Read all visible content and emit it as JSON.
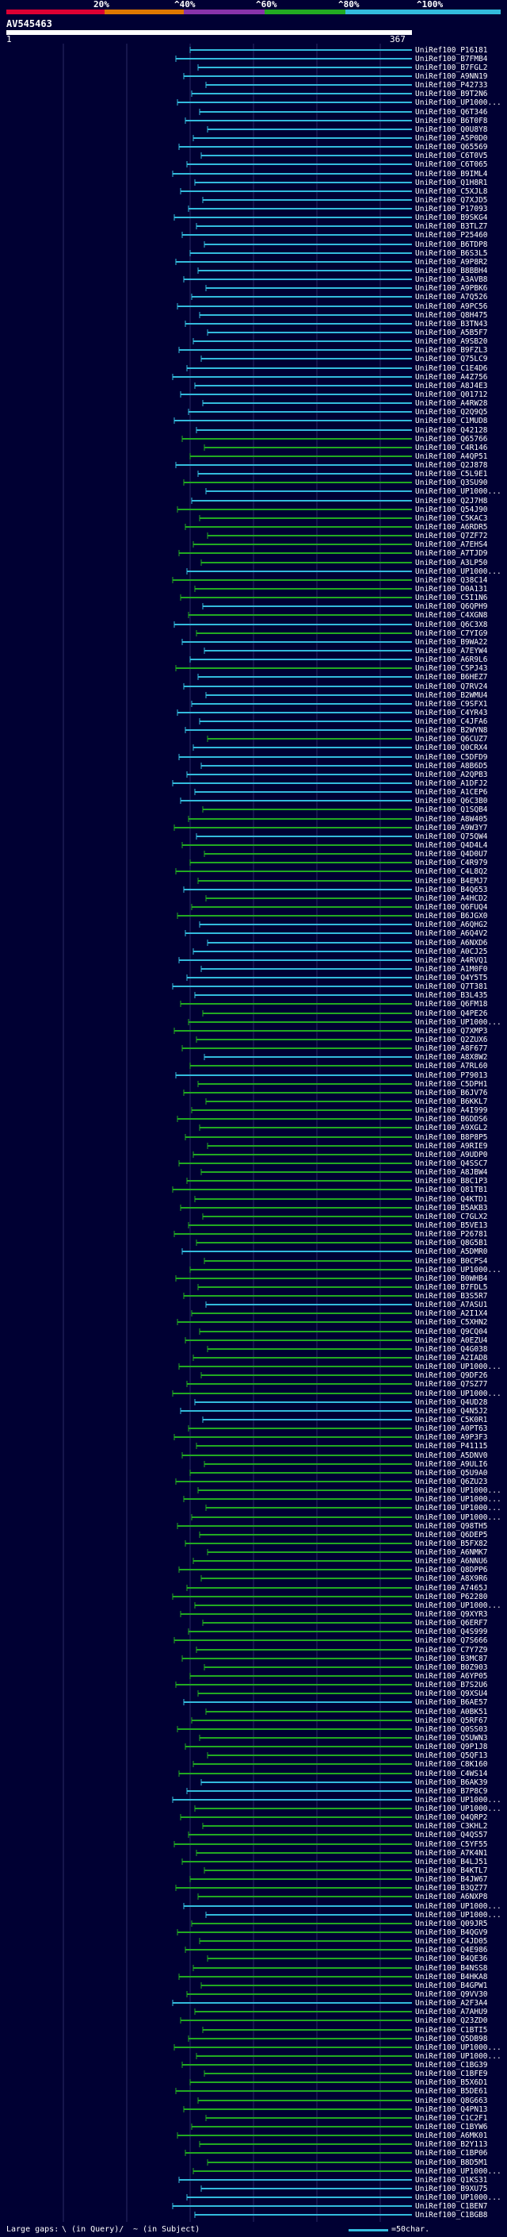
{
  "colors": {
    "background": "#000033",
    "query": "#ffffff",
    "band_20": "#dd0033",
    "band_40": "#dd7700",
    "band_60": "#8833aa",
    "band_80": "#22aa22",
    "band_100": "#33bbdd",
    "grid": "#2a2a66"
  },
  "scale": {
    "labels": [
      "20%",
      "^40%",
      "^60%",
      "^80%",
      "^100%"
    ]
  },
  "query": {
    "id": "AV545463",
    "start": "1",
    "end": "367"
  },
  "hits": [
    {
      "label": "UniRef100_P16181",
      "identity": 100
    },
    {
      "label": "UniRef100_B7FMB4",
      "identity": 100
    },
    {
      "label": "UniRef100_B7FGL2",
      "identity": 100
    },
    {
      "label": "UniRef100_A9NN19",
      "identity": 100
    },
    {
      "label": "UniRef100_P42733",
      "identity": 100
    },
    {
      "label": "UniRef100_B9T2N6",
      "identity": 100
    },
    {
      "label": "UniRef100_UP1000...",
      "identity": 100
    },
    {
      "label": "UniRef100_Q6T346",
      "identity": 100
    },
    {
      "label": "UniRef100_B6T0F8",
      "identity": 100
    },
    {
      "label": "UniRef100_Q0U8Y8",
      "identity": 100
    },
    {
      "label": "UniRef100_A5P0D0",
      "identity": 100
    },
    {
      "label": "UniRef100_Q65569",
      "identity": 100
    },
    {
      "label": "UniRef100_C6T0V5",
      "identity": 100
    },
    {
      "label": "UniRef100_C6T065",
      "identity": 100
    },
    {
      "label": "UniRef100_B9IML4",
      "identity": 100
    },
    {
      "label": "UniRef100_Q1H8R1",
      "identity": 100
    },
    {
      "label": "UniRef100_C5XJL8",
      "identity": 100
    },
    {
      "label": "UniRef100_Q7XJD5",
      "identity": 100
    },
    {
      "label": "UniRef100_P17093",
      "identity": 100
    },
    {
      "label": "UniRef100_B9SKG4",
      "identity": 100
    },
    {
      "label": "UniRef100_B3TLZ7",
      "identity": 100
    },
    {
      "label": "UniRef100_P25460",
      "identity": 100
    },
    {
      "label": "UniRef100_B6TDP8",
      "identity": 100
    },
    {
      "label": "UniRef100_B6S3L5",
      "identity": 100
    },
    {
      "label": "UniRef100_A9P8R2",
      "identity": 100
    },
    {
      "label": "UniRef100_B8BBH4",
      "identity": 100
    },
    {
      "label": "UniRef100_A3AVB8",
      "identity": 100
    },
    {
      "label": "UniRef100_A9PBK6",
      "identity": 100
    },
    {
      "label": "UniRef100_A7Q526",
      "identity": 100
    },
    {
      "label": "UniRef100_A9PC56",
      "identity": 100
    },
    {
      "label": "UniRef100_Q8H475",
      "identity": 100
    },
    {
      "label": "UniRef100_B3TN43",
      "identity": 100
    },
    {
      "label": "UniRef100_A5B5F7",
      "identity": 100
    },
    {
      "label": "UniRef100_A9SB20",
      "identity": 100
    },
    {
      "label": "UniRef100_B9FZL3",
      "identity": 100
    },
    {
      "label": "UniRef100_Q75LC9",
      "identity": 100
    },
    {
      "label": "UniRef100_C1E4D6",
      "identity": 100
    },
    {
      "label": "UniRef100_A4Z756",
      "identity": 100
    },
    {
      "label": "UniRef100_A8J4E3",
      "identity": 100
    },
    {
      "label": "UniRef100_Q01712",
      "identity": 100
    },
    {
      "label": "UniRef100_A4RW28",
      "identity": 100
    },
    {
      "label": "UniRef100_Q2Q9Q5",
      "identity": 100
    },
    {
      "label": "UniRef100_C1MUD8",
      "identity": 100
    },
    {
      "label": "UniRef100_Q42128",
      "identity": 100
    },
    {
      "label": "UniRef100_Q65766",
      "identity": 80
    },
    {
      "label": "UniRef100_C4R146",
      "identity": 80
    },
    {
      "label": "UniRef100_A4QP51",
      "identity": 80
    },
    {
      "label": "UniRef100_Q2J878",
      "identity": 100
    },
    {
      "label": "UniRef100_C5L9E1",
      "identity": 100
    },
    {
      "label": "UniRef100_Q3SU90",
      "identity": 80
    },
    {
      "label": "UniRef100_UP1000...",
      "identity": 100
    },
    {
      "label": "UniRef100_Q2J7H8",
      "identity": 100
    },
    {
      "label": "UniRef100_Q54J90",
      "identity": 80
    },
    {
      "label": "UniRef100_C5KAC3",
      "identity": 80
    },
    {
      "label": "UniRef100_A6RDR5",
      "identity": 80
    },
    {
      "label": "UniRef100_Q7ZF72",
      "identity": 80
    },
    {
      "label": "UniRef100_A7EHS4",
      "identity": 80
    },
    {
      "label": "UniRef100_A7TJD9",
      "identity": 80
    },
    {
      "label": "UniRef100_A3LP50",
      "identity": 80
    },
    {
      "label": "UniRef100_UP1000...",
      "identity": 100
    },
    {
      "label": "UniRef100_Q38C14",
      "identity": 80
    },
    {
      "label": "UniRef100_D0A131",
      "identity": 80
    },
    {
      "label": "UniRef100_C5I1N6",
      "identity": 80
    },
    {
      "label": "UniRef100_Q6QPH9",
      "identity": 100
    },
    {
      "label": "UniRef100_C4XGN8",
      "identity": 80
    },
    {
      "label": "UniRef100_Q6C3X8",
      "identity": 100
    },
    {
      "label": "UniRef100_C7YIG9",
      "identity": 80
    },
    {
      "label": "UniRef100_B9WA22",
      "identity": 100
    },
    {
      "label": "UniRef100_A7EYW4",
      "identity": 100
    },
    {
      "label": "UniRef100_A6R9L6",
      "identity": 100
    },
    {
      "label": "UniRef100_C5PJ43",
      "identity": 80
    },
    {
      "label": "UniRef100_B6HEZ7",
      "identity": 100
    },
    {
      "label": "UniRef100_Q7RV24",
      "identity": 100
    },
    {
      "label": "UniRef100_B2WMU4",
      "identity": 100
    },
    {
      "label": "UniRef100_C9SFX1",
      "identity": 100
    },
    {
      "label": "UniRef100_C4YR43",
      "identity": 100
    },
    {
      "label": "UniRef100_C4JFA6",
      "identity": 100
    },
    {
      "label": "UniRef100_B2WYN8",
      "identity": 100
    },
    {
      "label": "UniRef100_Q6CUZ7",
      "identity": 80
    },
    {
      "label": "UniRef100_Q0CRX4",
      "identity": 100
    },
    {
      "label": "UniRef100_C5DFD9",
      "identity": 100
    },
    {
      "label": "UniRef100_A8B6D5",
      "identity": 100
    },
    {
      "label": "UniRef100_A2QPB3",
      "identity": 100
    },
    {
      "label": "UniRef100_A1DFJ2",
      "identity": 100
    },
    {
      "label": "UniRef100_A1CEP6",
      "identity": 100
    },
    {
      "label": "UniRef100_Q6C3B0",
      "identity": 100
    },
    {
      "label": "UniRef100_Q1SQB4",
      "identity": 80
    },
    {
      "label": "UniRef100_A8W405",
      "identity": 80
    },
    {
      "label": "UniRef100_A9W3Y7",
      "identity": 80
    },
    {
      "label": "UniRef100_Q75QW4",
      "identity": 100
    },
    {
      "label": "UniRef100_Q4D4L4",
      "identity": 80
    },
    {
      "label": "UniRef100_Q4D0U7",
      "identity": 80
    },
    {
      "label": "UniRef100_C4R979",
      "identity": 80
    },
    {
      "label": "UniRef100_C4L8Q2",
      "identity": 80
    },
    {
      "label": "UniRef100_B4EMJ7",
      "identity": 80
    },
    {
      "label": "UniRef100_B4Q653",
      "identity": 100
    },
    {
      "label": "UniRef100_A4HCD2",
      "identity": 80
    },
    {
      "label": "UniRef100_Q6FUQ4",
      "identity": 80
    },
    {
      "label": "UniRef100_B6JGX0",
      "identity": 80
    },
    {
      "label": "UniRef100_A6QHG2",
      "identity": 100
    },
    {
      "label": "UniRef100_A6Q4V2",
      "identity": 100
    },
    {
      "label": "UniRef100_A6NXD6",
      "identity": 100
    },
    {
      "label": "UniRef100_A0CJ25",
      "identity": 100
    },
    {
      "label": "UniRef100_A4RVQ1",
      "identity": 100
    },
    {
      "label": "UniRef100_A1M0F0",
      "identity": 100
    },
    {
      "label": "UniRef100_Q4Y5T5",
      "identity": 100
    },
    {
      "label": "UniRef100_Q7T381",
      "identity": 100
    },
    {
      "label": "UniRef100_B3L435",
      "identity": 100
    },
    {
      "label": "UniRef100_Q6FM18",
      "identity": 80
    },
    {
      "label": "UniRef100_Q4PE26",
      "identity": 80
    },
    {
      "label": "UniRef100_UP1000...",
      "identity": 80
    },
    {
      "label": "UniRef100_Q7XMP3",
      "identity": 80
    },
    {
      "label": "UniRef100_Q2ZUX6",
      "identity": 80
    },
    {
      "label": "UniRef100_A8F677",
      "identity": 80
    },
    {
      "label": "UniRef100_A8X8W2",
      "identity": 100
    },
    {
      "label": "UniRef100_A7RL60",
      "identity": 80
    },
    {
      "label": "UniRef100_P79013",
      "identity": 100
    },
    {
      "label": "UniRef100_C5DPH1",
      "identity": 80
    },
    {
      "label": "UniRef100_B6JV76",
      "identity": 80
    },
    {
      "label": "UniRef100_B6KKL7",
      "identity": 80
    },
    {
      "label": "UniRef100_A4I999",
      "identity": 80
    },
    {
      "label": "UniRef100_B6DDS6",
      "identity": 80
    },
    {
      "label": "UniRef100_A9XGL2",
      "identity": 80
    },
    {
      "label": "UniRef100_B8P8P5",
      "identity": 80
    },
    {
      "label": "UniRef100_A9RIE9",
      "identity": 80
    },
    {
      "label": "UniRef100_A9UDP0",
      "identity": 80
    },
    {
      "label": "UniRef100_Q4SSC7",
      "identity": 80
    },
    {
      "label": "UniRef100_A8JBW4",
      "identity": 80
    },
    {
      "label": "UniRef100_B8C1P3",
      "identity": 80
    },
    {
      "label": "UniRef100_Q81TB1",
      "identity": 80
    },
    {
      "label": "UniRef100_Q4KTD1",
      "identity": 80
    },
    {
      "label": "UniRef100_B5AKB3",
      "identity": 80
    },
    {
      "label": "UniRef100_C7GLX2",
      "identity": 80
    },
    {
      "label": "UniRef100_B5VE13",
      "identity": 80
    },
    {
      "label": "UniRef100_P26781",
      "identity": 80
    },
    {
      "label": "UniRef100_Q8G5B1",
      "identity": 80
    },
    {
      "label": "UniRef100_A5DMR0",
      "identity": 100
    },
    {
      "label": "UniRef100_B0CPS4",
      "identity": 80
    },
    {
      "label": "UniRef100_UP1000...",
      "identity": 80
    },
    {
      "label": "UniRef100_B0WHB4",
      "identity": 80
    },
    {
      "label": "UniRef100_B7FDL5",
      "identity": 80
    },
    {
      "label": "UniRef100_B3S5R7",
      "identity": 80
    },
    {
      "label": "UniRef100_A7ASU1",
      "identity": 100
    },
    {
      "label": "UniRef100_A2I1X4",
      "identity": 80
    },
    {
      "label": "UniRef100_C5XHN2",
      "identity": 80
    },
    {
      "label": "UniRef100_Q9CQ04",
      "identity": 80
    },
    {
      "label": "UniRef100_A0EZU4",
      "identity": 80
    },
    {
      "label": "UniRef100_Q4G038",
      "identity": 80
    },
    {
      "label": "UniRef100_A2IAD8",
      "identity": 80
    },
    {
      "label": "UniRef100_UP1000...",
      "identity": 80
    },
    {
      "label": "UniRef100_Q9DF26",
      "identity": 80
    },
    {
      "label": "UniRef100_Q7SZ77",
      "identity": 80
    },
    {
      "label": "UniRef100_UP1000...",
      "identity": 80
    },
    {
      "label": "UniRef100_Q4UD28",
      "identity": 100
    },
    {
      "label": "UniRef100_Q4N5J2",
      "identity": 100
    },
    {
      "label": "UniRef100_C5K0R1",
      "identity": 100
    },
    {
      "label": "UniRef100_A0PT63",
      "identity": 80
    },
    {
      "label": "UniRef100_A9P3F3",
      "identity": 80
    },
    {
      "label": "UniRef100_P41115",
      "identity": 80
    },
    {
      "label": "UniRef100_A5DNV0",
      "identity": 80
    },
    {
      "label": "UniRef100_A9ULI6",
      "identity": 80
    },
    {
      "label": "UniRef100_Q5U9A0",
      "identity": 80
    },
    {
      "label": "UniRef100_Q6ZU23",
      "identity": 80
    },
    {
      "label": "UniRef100_UP1000...",
      "identity": 80
    },
    {
      "label": "UniRef100_UP1000...",
      "identity": 80
    },
    {
      "label": "UniRef100_UP1000...",
      "identity": 80
    },
    {
      "label": "UniRef100_UP1000...",
      "identity": 80
    },
    {
      "label": "UniRef100_Q98TH5",
      "identity": 80
    },
    {
      "label": "UniRef100_Q6DEP5",
      "identity": 80
    },
    {
      "label": "UniRef100_B5FX82",
      "identity": 80
    },
    {
      "label": "UniRef100_A6NMK7",
      "identity": 80
    },
    {
      "label": "UniRef100_A6NNU6",
      "identity": 80
    },
    {
      "label": "UniRef100_Q8DPP6",
      "identity": 80
    },
    {
      "label": "UniRef100_A8X9R6",
      "identity": 80
    },
    {
      "label": "UniRef100_A7465J",
      "identity": 80
    },
    {
      "label": "UniRef100_P62280",
      "identity": 80
    },
    {
      "label": "UniRef100_UP1000...",
      "identity": 80
    },
    {
      "label": "UniRef100_Q9XYR3",
      "identity": 80
    },
    {
      "label": "UniRef100_Q6ERF7",
      "identity": 80
    },
    {
      "label": "UniRef100_Q4S999",
      "identity": 80
    },
    {
      "label": "UniRef100_Q7S666",
      "identity": 80
    },
    {
      "label": "UniRef100_C7Y7Z9",
      "identity": 80
    },
    {
      "label": "UniRef100_B3MC87",
      "identity": 80
    },
    {
      "label": "UniRef100_B0Z903",
      "identity": 80
    },
    {
      "label": "UniRef100_A6YP05",
      "identity": 80
    },
    {
      "label": "UniRef100_B7S2U6",
      "identity": 80
    },
    {
      "label": "UniRef100_Q9XSU4",
      "identity": 80
    },
    {
      "label": "UniRef100_B6AE57",
      "identity": 100
    },
    {
      "label": "UniRef100_A0BK51",
      "identity": 80
    },
    {
      "label": "UniRef100_Q5RF67",
      "identity": 80
    },
    {
      "label": "UniRef100_Q0SS03",
      "identity": 80
    },
    {
      "label": "UniRef100_Q5UWN3",
      "identity": 80
    },
    {
      "label": "UniRef100_Q9P1J8",
      "identity": 80
    },
    {
      "label": "UniRef100_Q5QF13",
      "identity": 80
    },
    {
      "label": "UniRef100_C8K160",
      "identity": 80
    },
    {
      "label": "UniRef100_C4WS14",
      "identity": 80
    },
    {
      "label": "UniRef100_B6AK39",
      "identity": 100
    },
    {
      "label": "UniRef100_B7P8C9",
      "identity": 100
    },
    {
      "label": "UniRef100_UP1000...",
      "identity": 100
    },
    {
      "label": "UniRef100_UP1000...",
      "identity": 80
    },
    {
      "label": "UniRef100_Q4QRP2",
      "identity": 80
    },
    {
      "label": "UniRef100_C3KHL2",
      "identity": 80
    },
    {
      "label": "UniRef100_Q4QS57",
      "identity": 80
    },
    {
      "label": "UniRef100_C5YF55",
      "identity": 80
    },
    {
      "label": "UniRef100_A7K4N1",
      "identity": 80
    },
    {
      "label": "UniRef100_B4LJ51",
      "identity": 80
    },
    {
      "label": "UniRef100_B4KTL7",
      "identity": 80
    },
    {
      "label": "UniRef100_B4JW67",
      "identity": 80
    },
    {
      "label": "UniRef100_B3QZ77",
      "identity": 80
    },
    {
      "label": "UniRef100_A6NXP8",
      "identity": 80
    },
    {
      "label": "UniRef100_UP1000...",
      "identity": 100
    },
    {
      "label": "UniRef100_UP1000...",
      "identity": 100
    },
    {
      "label": "UniRef100_Q09JR5",
      "identity": 80
    },
    {
      "label": "UniRef100_B4QGV9",
      "identity": 80
    },
    {
      "label": "UniRef100_C4JD05",
      "identity": 80
    },
    {
      "label": "UniRef100_Q4E986",
      "identity": 80
    },
    {
      "label": "UniRef100_B4QE36",
      "identity": 80
    },
    {
      "label": "UniRef100_B4NSS8",
      "identity": 80
    },
    {
      "label": "UniRef100_B4HKA8",
      "identity": 80
    },
    {
      "label": "UniRef100_B4GPW1",
      "identity": 80
    },
    {
      "label": "UniRef100_Q9VV30",
      "identity": 80
    },
    {
      "label": "UniRef100_A2F3A4",
      "identity": 100
    },
    {
      "label": "UniRef100_A7AHU9",
      "identity": 80
    },
    {
      "label": "UniRef100_Q23ZD0",
      "identity": 80
    },
    {
      "label": "UniRef100_C1BTI5",
      "identity": 80
    },
    {
      "label": "UniRef100_Q5DB98",
      "identity": 80
    },
    {
      "label": "UniRef100_UP1000...",
      "identity": 80
    },
    {
      "label": "UniRef100_UP1000...",
      "identity": 80
    },
    {
      "label": "UniRef100_C1BG39",
      "identity": 80
    },
    {
      "label": "UniRef100_C1BFE9",
      "identity": 80
    },
    {
      "label": "UniRef100_B5X6D1",
      "identity": 80
    },
    {
      "label": "UniRef100_B5DE61",
      "identity": 80
    },
    {
      "label": "UniRef100_Q8G663",
      "identity": 80
    },
    {
      "label": "UniRef100_Q4PN13",
      "identity": 80
    },
    {
      "label": "UniRef100_C1C2F1",
      "identity": 80
    },
    {
      "label": "UniRef100_C1BYW6",
      "identity": 80
    },
    {
      "label": "UniRef100_A6MK01",
      "identity": 80
    },
    {
      "label": "UniRef100_B2Y113",
      "identity": 80
    },
    {
      "label": "UniRef100_C1BP06",
      "identity": 80
    },
    {
      "label": "UniRef100_B8D5M1",
      "identity": 80
    },
    {
      "label": "UniRef100_UP1000...",
      "identity": 80
    },
    {
      "label": "UniRef100_Q1KS31",
      "identity": 100
    },
    {
      "label": "UniRef100_B9XU75",
      "identity": 100
    },
    {
      "label": "UniRef100_UP1000...",
      "identity": 100
    },
    {
      "label": "UniRef100_C1BEN7",
      "identity": 100
    },
    {
      "label": "UniRef100_C1BGB8",
      "identity": 100
    }
  ],
  "legend": {
    "large_gaps": "Large gaps:",
    "in_query": "\\ (in Query)/",
    "in_subject": "~ (in Subject)",
    "scale_text": "=50char."
  }
}
